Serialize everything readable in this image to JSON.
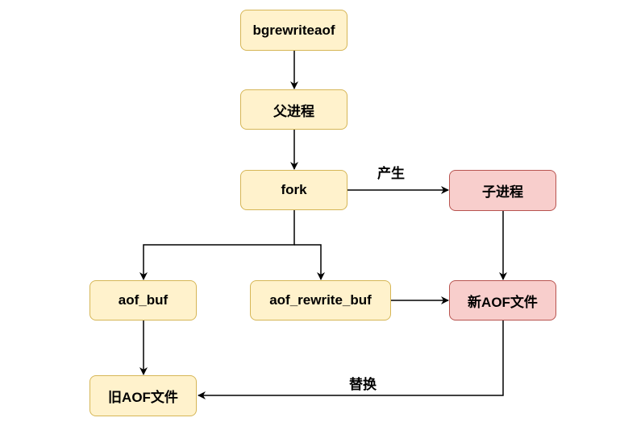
{
  "nodes": {
    "bgrewriteaof": "bgrewriteaof",
    "parent": "父进程",
    "fork": "fork",
    "child": "子进程",
    "aof_buf": "aof_buf",
    "aof_rewrite_buf": "aof_rewrite_buf",
    "new_aof": "新AOF文件",
    "old_aof": "旧AOF文件"
  },
  "edge_labels": {
    "spawn": "产生",
    "replace": "替换"
  },
  "colors": {
    "yellow_fill": "#fff2cc",
    "yellow_stroke": "#d6b656",
    "red_fill": "#f8cecc",
    "red_stroke": "#b85450"
  }
}
